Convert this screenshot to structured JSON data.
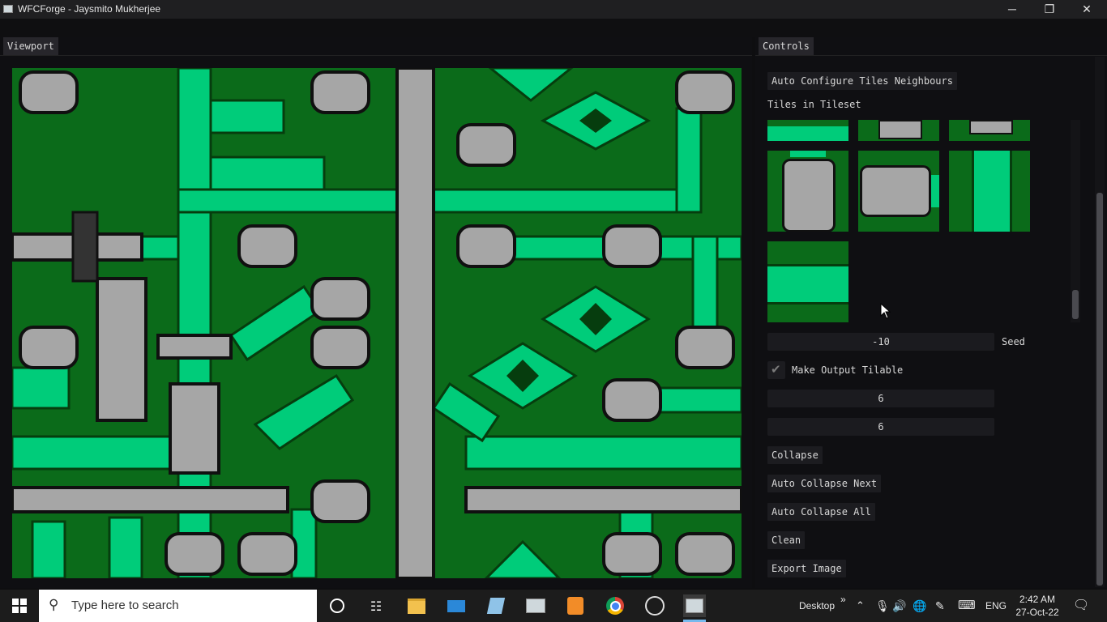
{
  "window": {
    "title": "WFCForge - Jaysmito Mukherjee",
    "minimize": "─",
    "restore": "❐",
    "close": "✕"
  },
  "viewport": {
    "tab_label": "Viewport"
  },
  "controls": {
    "tab_label": "Controls",
    "auto_configure_button": "Auto Configure Tiles Neighbours",
    "tiles_heading": "Tiles in Tileset",
    "seed_value": "-10",
    "seed_label": "Seed",
    "tilable_label": "Make Output Tilable",
    "width_value": "6",
    "height_value": "6",
    "collapse_button": "Collapse",
    "auto_collapse_next_button": "Auto Collapse Next",
    "auto_collapse_all_button": "Auto Collapse All",
    "clean_button": "Clean",
    "export_button": "Export Image"
  },
  "taskbar": {
    "search_placeholder": "Type here to search",
    "desktop_label": "Desktop",
    "chevron": "»",
    "language": "ENG",
    "time": "2:42 AM",
    "date": "27-Oct-22"
  },
  "colors": {
    "dark_green": "#0b6b1a",
    "bright_green": "#00cc7a",
    "grey": "#a6a6a6"
  }
}
